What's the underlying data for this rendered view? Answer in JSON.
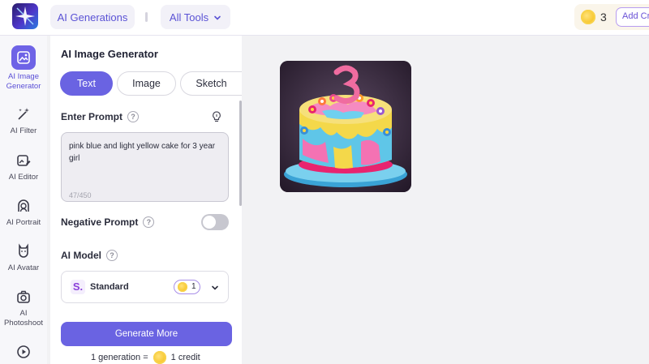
{
  "header": {
    "logo_icon": "spark-logo-icon",
    "ai_generations_label": "AI Generations",
    "all_tools_label": "All Tools",
    "credits_count": "3",
    "add_credits_label": "Add Cre"
  },
  "sidebar": {
    "items": [
      {
        "label": "AI Image Generator",
        "icon": "image-generator-icon",
        "active": true
      },
      {
        "label": "AI Filter",
        "icon": "wand-icon"
      },
      {
        "label": "AI Editor",
        "icon": "image-edit-icon"
      },
      {
        "label": "AI Portrait",
        "icon": "portrait-icon"
      },
      {
        "label": "AI Avatar",
        "icon": "avatar-icon"
      },
      {
        "label": "AI Photoshoot",
        "icon": "camera-icon"
      },
      {
        "label": "",
        "icon": "video-icon"
      }
    ]
  },
  "panel": {
    "title": "AI Image Generator",
    "tabs": [
      {
        "label": "Text",
        "active": true
      },
      {
        "label": "Image"
      },
      {
        "label": "Sketch"
      }
    ],
    "prompt": {
      "label": "Enter Prompt",
      "help": "?",
      "value": "pink blue and light yellow cake for 3 year girl",
      "counter": "47/450"
    },
    "negative_prompt": {
      "label": "Negative Prompt",
      "help": "?",
      "enabled": false
    },
    "ai_model": {
      "label": "AI Model",
      "help": "?",
      "logo_text": "S.",
      "name": "Standard",
      "cost": "1"
    },
    "generate_label": "Generate More",
    "generation_info_left": "1 generation =",
    "generation_info_right": "1 credit"
  },
  "colors": {
    "accent": "#6a63e2",
    "panel_bg": "#ffffff",
    "page_bg": "#f2f2f4"
  }
}
